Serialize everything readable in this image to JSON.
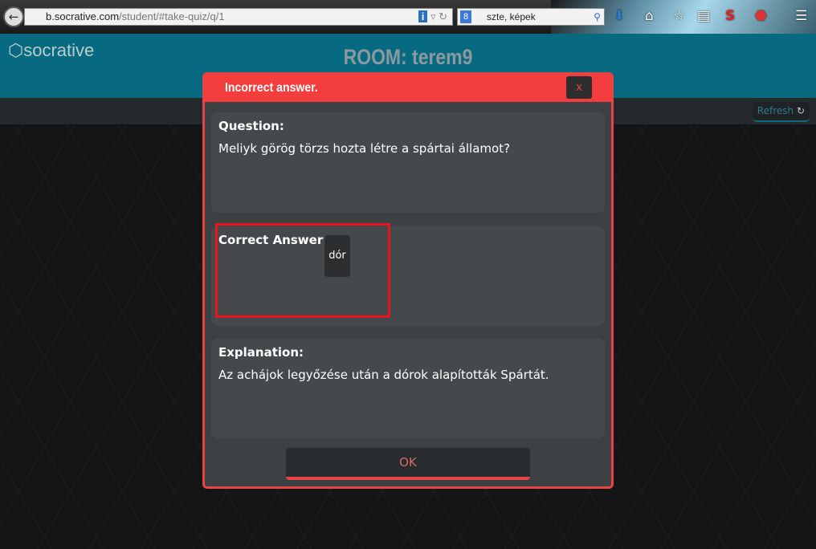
{
  "browser": {
    "url_domain": "b.socrative.com",
    "url_path": "/student/#take-quiz/q/1",
    "search_value": "szte, képek",
    "icons": [
      "back-icon",
      "globe-icon",
      "info-icon",
      "reload-icon",
      "google-icon",
      "search-icon",
      "download-icon",
      "home-icon",
      "star-icon",
      "reading-list-icon",
      "s-icon",
      "adblock-icon",
      "menu-icon"
    ]
  },
  "header": {
    "logo": "socrative",
    "room": "ROOM: terem9",
    "refresh_label": "Refresh"
  },
  "modal": {
    "title": "Incorrect answer.",
    "close_label": "x",
    "question_label": "Question:",
    "question_text": "Meliyk görög törzs hozta létre a spártai államot?",
    "correct_label": "Correct Answer:",
    "correct_value": "dór",
    "explanation_label": "Explanation:",
    "explanation_text": "Az achájok legyőzése után a dórok alapították Spártát.",
    "ok_label": "OK"
  },
  "colors": {
    "header": "#076a80",
    "modal_red": "#f43d3d",
    "highlight": "#e8141e"
  }
}
